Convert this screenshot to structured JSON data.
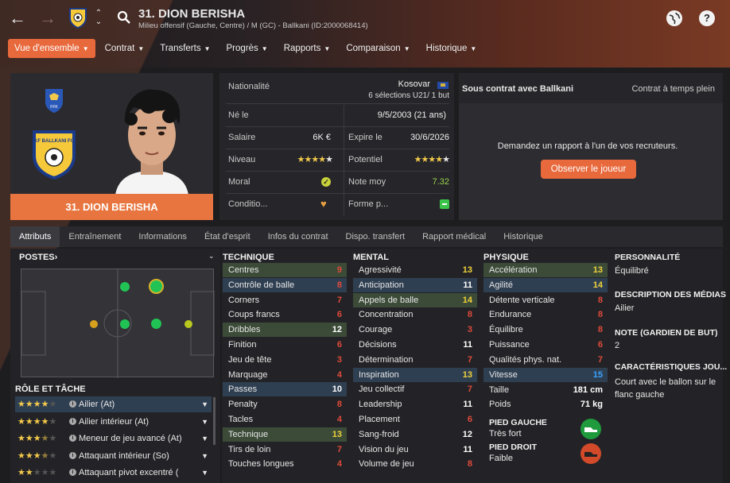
{
  "header": {
    "back": "←",
    "forward": "→",
    "player_name": "31. DION BERISHA",
    "subtitle": "Milieu offensif (Gauche, Centre) / M (GC) - Ballkani (ID:2000068414)",
    "globe_icon": "globe-icon",
    "help_label": "?"
  },
  "tabs": [
    {
      "label": "Vue d'ensemble",
      "active": true
    },
    {
      "label": "Contrat"
    },
    {
      "label": "Transferts"
    },
    {
      "label": "Progrès"
    },
    {
      "label": "Rapports"
    },
    {
      "label": "Comparaison"
    },
    {
      "label": "Historique"
    }
  ],
  "profile": {
    "name_bar": "31. DION BERISHA",
    "club_badge_text": "KF BALLKANI FC",
    "federation_text": "FFK"
  },
  "info": {
    "nationality_label": "Nationalité",
    "nationality_value": "Kosovar",
    "caps": "6 sélections U21/ 1 but",
    "born_label": "Né le",
    "born_value": "9/5/2003 (21 ans)",
    "salary_label": "Salaire",
    "salary_value": "6K €",
    "expires_label": "Expire le",
    "expires_value": "30/6/2026",
    "level_label": "Niveau",
    "level_stars": 4,
    "potential_label": "Potentiel",
    "potential_stars": 4.5,
    "morale_label": "Moral",
    "avg_label": "Note moy",
    "avg_value": "7.32",
    "condition_label": "Conditio...",
    "form_label": "Forme p..."
  },
  "contract": {
    "title": "Sous contrat avec Ballkani",
    "type": "Contrat à temps plein",
    "message": "Demandez un rapport à l'un de vos recruteurs.",
    "button": "Observer le joueur"
  },
  "subtabs": [
    "Attributs",
    "Entraînement",
    "Informations",
    "État d'esprit",
    "Infos du contrat",
    "Dispo. transfert",
    "Rapport médical",
    "Historique"
  ],
  "positions": {
    "title": "POSTES",
    "chevron": "›"
  },
  "roles": {
    "title": "RÔLE ET TÂCHE",
    "items": [
      {
        "stars": 4,
        "label": "Ailier (At)",
        "selected": true
      },
      {
        "stars": 4,
        "label": "Ailier intérieur (At)"
      },
      {
        "stars": 3.5,
        "label": "Meneur de jeu avancé (At)"
      },
      {
        "stars": 3.5,
        "label": "Attaquant intérieur (So)"
      },
      {
        "stars": 2,
        "label": "Attaquant pivot excentré ("
      }
    ]
  },
  "technique": {
    "title": "TECHNIQUE",
    "rows": [
      {
        "name": "Centres",
        "value": "9",
        "color": "red",
        "hl": "green"
      },
      {
        "name": "Contrôle de balle",
        "value": "8",
        "color": "red",
        "hl": "blue"
      },
      {
        "name": "Corners",
        "value": "7",
        "color": "red"
      },
      {
        "name": "Coups francs",
        "value": "6",
        "color": "red"
      },
      {
        "name": "Dribbles",
        "value": "12",
        "color": "white",
        "hl": "green"
      },
      {
        "name": "Finition",
        "value": "6",
        "color": "red"
      },
      {
        "name": "Jeu de tête",
        "value": "3",
        "color": "red"
      },
      {
        "name": "Marquage",
        "value": "4",
        "color": "red"
      },
      {
        "name": "Passes",
        "value": "10",
        "color": "white",
        "hl": "blue"
      },
      {
        "name": "Penalty",
        "value": "8",
        "color": "red"
      },
      {
        "name": "Tacles",
        "value": "4",
        "color": "red"
      },
      {
        "name": "Technique",
        "value": "13",
        "color": "yel",
        "hl": "green"
      },
      {
        "name": "Tirs de loin",
        "value": "7",
        "color": "red"
      },
      {
        "name": "Touches longues",
        "value": "4",
        "color": "red"
      }
    ]
  },
  "mental": {
    "title": "MENTAL",
    "rows": [
      {
        "name": "Agressivité",
        "value": "13",
        "color": "yel"
      },
      {
        "name": "Anticipation",
        "value": "11",
        "color": "white",
        "hl": "blue"
      },
      {
        "name": "Appels de balle",
        "value": "14",
        "color": "yel",
        "hl": "green"
      },
      {
        "name": "Concentration",
        "value": "8",
        "color": "red"
      },
      {
        "name": "Courage",
        "value": "3",
        "color": "red"
      },
      {
        "name": "Décisions",
        "value": "11",
        "color": "white"
      },
      {
        "name": "Détermination",
        "value": "7",
        "color": "red"
      },
      {
        "name": "Inspiration",
        "value": "13",
        "color": "yel",
        "hl": "blue"
      },
      {
        "name": "Jeu collectif",
        "value": "7",
        "color": "red"
      },
      {
        "name": "Leadership",
        "value": "11",
        "color": "white"
      },
      {
        "name": "Placement",
        "value": "6",
        "color": "red"
      },
      {
        "name": "Sang-froid",
        "value": "12",
        "color": "white"
      },
      {
        "name": "Vision du jeu",
        "value": "11",
        "color": "white"
      },
      {
        "name": "Volume de jeu",
        "value": "8",
        "color": "red"
      }
    ]
  },
  "physique": {
    "title": "PHYSIQUE",
    "rows": [
      {
        "name": "Accélération",
        "value": "13",
        "color": "yel",
        "hl": "green"
      },
      {
        "name": "Agilité",
        "value": "14",
        "color": "yel",
        "hl": "blue"
      },
      {
        "name": "Détente verticale",
        "value": "8",
        "color": "red"
      },
      {
        "name": "Endurance",
        "value": "8",
        "color": "red"
      },
      {
        "name": "Équilibre",
        "value": "8",
        "color": "red"
      },
      {
        "name": "Puissance",
        "value": "6",
        "color": "red"
      },
      {
        "name": "Qualités phys. nat.",
        "value": "7",
        "color": "red"
      },
      {
        "name": "Vitesse",
        "value": "15",
        "color": "blu",
        "hl": "blue"
      }
    ],
    "height_label": "Taille",
    "height_value": "181 cm",
    "weight_label": "Poids",
    "weight_value": "71 kg",
    "left_foot_title": "PIED GAUCHE",
    "left_foot_value": "Très fort",
    "right_foot_title": "PIED DROIT",
    "right_foot_value": "Faible"
  },
  "personality": {
    "h1": "PERSONNALITÉ",
    "v1": "Équilibré",
    "h2": "DESCRIPTION DES MÉDIAS",
    "v2": "Ailier",
    "h3": "NOTE (GARDIEN DE BUT)",
    "v3": "2",
    "h4": "CARACTÉRISTIQUES JOU...",
    "v4": "Court avec le ballon sur le flanc gauche"
  },
  "colors": {
    "accent": "#e8693c",
    "green_hl": "#3b4b38",
    "blue_hl": "#2f3f52"
  }
}
